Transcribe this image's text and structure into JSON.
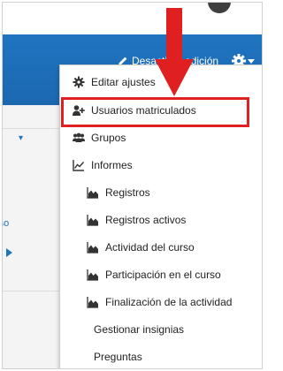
{
  "header": {
    "edit_label": "Desactivar edición",
    "accent_color": "#1f74c0"
  },
  "menu": {
    "items": [
      {
        "label": "Editar ajustes",
        "icon": "gear-icon"
      },
      {
        "label": "Usuarios matriculados",
        "icon": "enrol-users-icon",
        "highlighted": true
      },
      {
        "label": "Grupos",
        "icon": "groups-icon"
      },
      {
        "label": "Informes",
        "icon": "line-chart-icon"
      },
      {
        "label": "Registros",
        "icon": "area-chart-icon"
      },
      {
        "label": "Registros activos",
        "icon": "area-chart-icon"
      },
      {
        "label": "Actividad del curso",
        "icon": "area-chart-icon"
      },
      {
        "label": "Participación en el curso",
        "icon": "area-chart-icon"
      },
      {
        "label": "Finalización de la actividad",
        "icon": "area-chart-icon"
      },
      {
        "label": "Gestionar insignias",
        "icon": ""
      },
      {
        "label": "Preguntas",
        "icon": ""
      }
    ]
  },
  "background": {
    "partial_link_text": "rso"
  },
  "annotation": {
    "arrow_color": "#e02020",
    "highlight_color": "#e02020"
  }
}
